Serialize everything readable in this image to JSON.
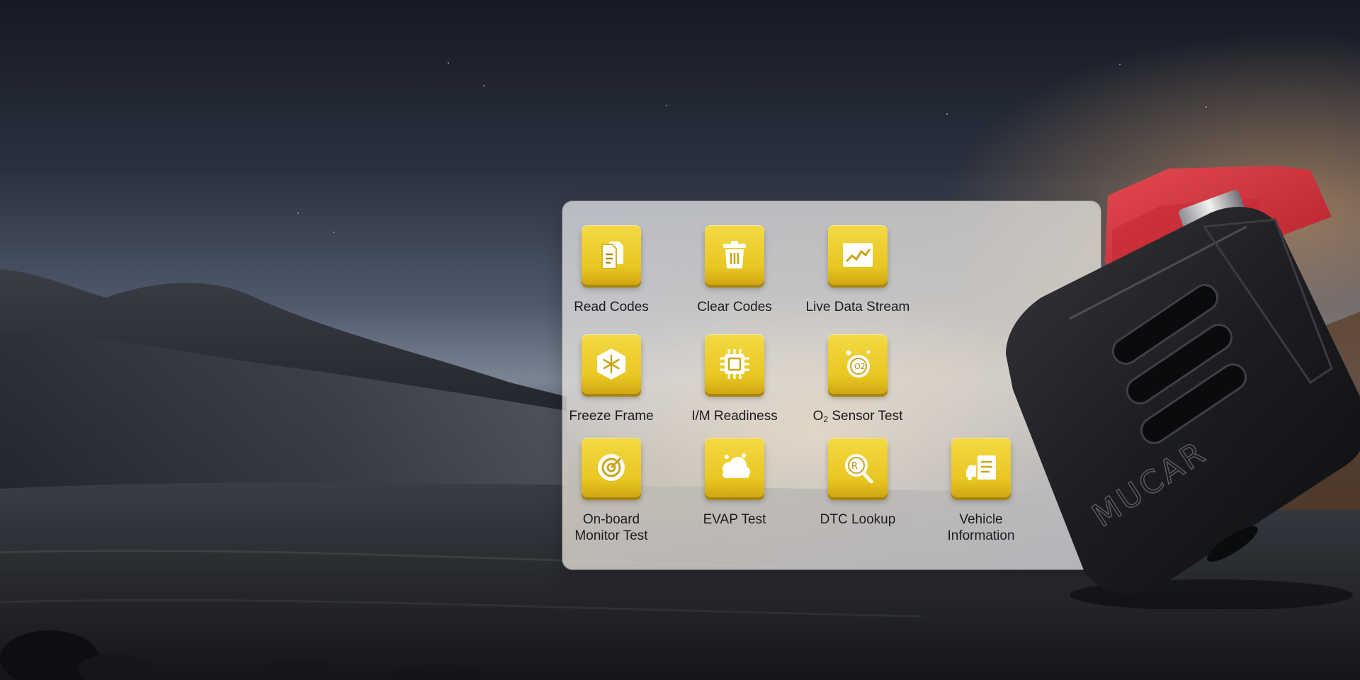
{
  "features": [
    {
      "label": "Read Codes",
      "icon": "document-icon"
    },
    {
      "label": "Clear Codes",
      "icon": "trash-icon"
    },
    {
      "label": "Live Data Stream",
      "icon": "graph-icon"
    },
    {
      "label": "Freeze Frame",
      "icon": "snowflake-icon"
    },
    {
      "label": "I/M Readiness",
      "icon": "chip-icon"
    },
    {
      "label_prefix": "O",
      "label_sub": "2",
      "label_suffix": " Sensor Test",
      "icon": "o2-sensor-icon"
    },
    {
      "label": "On-board\nMonitor Test",
      "icon": "target-icon"
    },
    {
      "label": "EVAP Test",
      "icon": "cloud-icon"
    },
    {
      "label": "DTC Lookup",
      "icon": "dtc-lookup-icon"
    },
    {
      "label": "Vehicle\nInformation",
      "icon": "vehicle-info-icon"
    }
  ],
  "device": {
    "brand": "MUCAR"
  },
  "colors": {
    "tile": "#e9c722",
    "plug_red": "#d8303a",
    "device_body": "#1b1c1f"
  }
}
